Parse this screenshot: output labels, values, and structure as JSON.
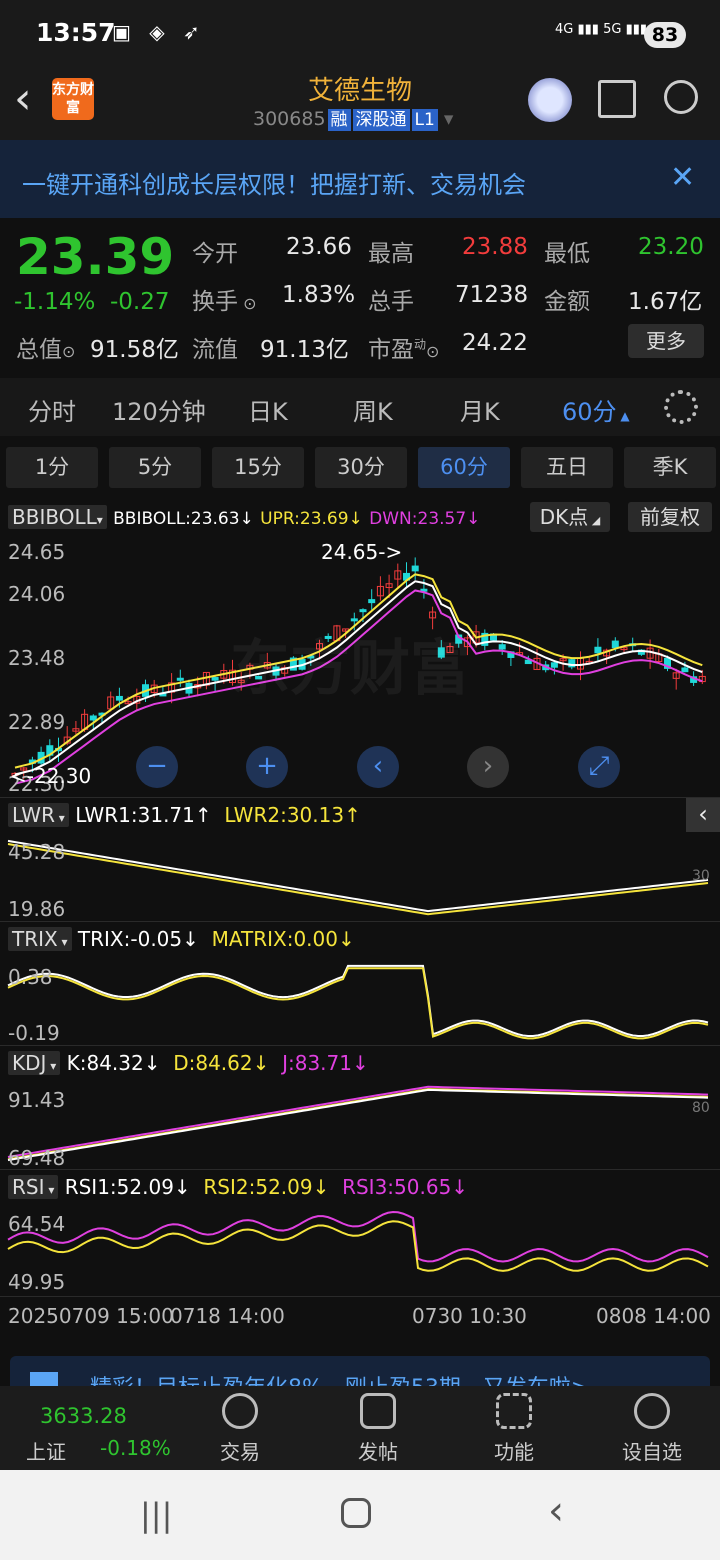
{
  "status": {
    "time": "13:57",
    "net1": "4G",
    "net2": "5G",
    "battery": "83"
  },
  "header": {
    "logo": "东方财富",
    "name": "艾德生物",
    "code": "300685",
    "tags": [
      "融",
      "深股通",
      "L1"
    ]
  },
  "banner": {
    "text": "一键开通科创成长层权限！把握打新、交易机会"
  },
  "quote": {
    "price": "23.39",
    "change_pct": "-1.14%",
    "change": "-0.27",
    "open_label": "今开",
    "open": "23.66",
    "high_label": "最高",
    "high": "23.88",
    "low_label": "最低",
    "low": "23.20",
    "turnover_label": "换手",
    "turnover": "1.83%",
    "volume_label": "总手",
    "volume": "71238",
    "amount_label": "金额",
    "amount": "1.67亿",
    "mktcap_label": "总值",
    "mktcap": "91.58亿",
    "float_label": "流值",
    "float": "91.13亿",
    "pe_label": "市盈",
    "pe_sup": "动",
    "pe": "24.22",
    "more": "更多"
  },
  "period_tabs": [
    "分时",
    "120分钟",
    "日K",
    "周K",
    "月K",
    "60分"
  ],
  "min_buttons": [
    "1分",
    "5分",
    "15分",
    "30分",
    "60分",
    "五日",
    "季K"
  ],
  "chart": {
    "main_indicator": "BBIBOLL",
    "bbiboll": "BBIBOLL:23.63↓",
    "upr": "UPR:23.69↓",
    "dwn": "DWN:23.57↓",
    "dk_button": "DK点",
    "adjust_button": "前复权",
    "y_labels": [
      "24.65",
      "24.06",
      "23.48",
      "22.89",
      "22.30"
    ],
    "high_marker": "24.65->",
    "low_marker": "<-22.30",
    "watermark": "东方财富"
  },
  "lwr": {
    "name": "LWR",
    "v1": "LWR1:31.71↑",
    "v2": "LWR2:30.13↑",
    "top": "45.28",
    "bottom": "19.86",
    "right": "30"
  },
  "trix": {
    "name": "TRIX",
    "v1": "TRIX:-0.05↓",
    "v2": "MATRIX:0.00↓",
    "top": "0.38",
    "bottom": "-0.19"
  },
  "kdj": {
    "name": "KDJ",
    "k": "K:84.32↓",
    "d": "D:84.62↓",
    "j": "J:83.71↓",
    "top": "91.43",
    "bottom": "69.48",
    "right": "80"
  },
  "rsi": {
    "name": "RSI",
    "r1": "RSI1:52.09↓",
    "r2": "RSI2:52.09↓",
    "r3": "RSI3:50.65↓",
    "top": "64.54",
    "bottom": "49.95"
  },
  "dates": [
    "20250709 15:00",
    "0718 14:00",
    "0730 10:30",
    "0808 14:00"
  ],
  "promo": {
    "text": "精彩！目标止盈年化8%，刚止盈53期，又发车啦>"
  },
  "bottom": {
    "index_value": "3633.28",
    "index_name": "上证",
    "index_change": "-0.18%",
    "items": [
      "交易",
      "发帖",
      "功能",
      "设自选"
    ]
  },
  "colors": {
    "up": "#f23c3c",
    "down": "#2fc42f",
    "accent": "#4d8ff0",
    "yellow": "#f5e43c",
    "magenta": "#e040e0",
    "cyan": "#20d8d8"
  }
}
